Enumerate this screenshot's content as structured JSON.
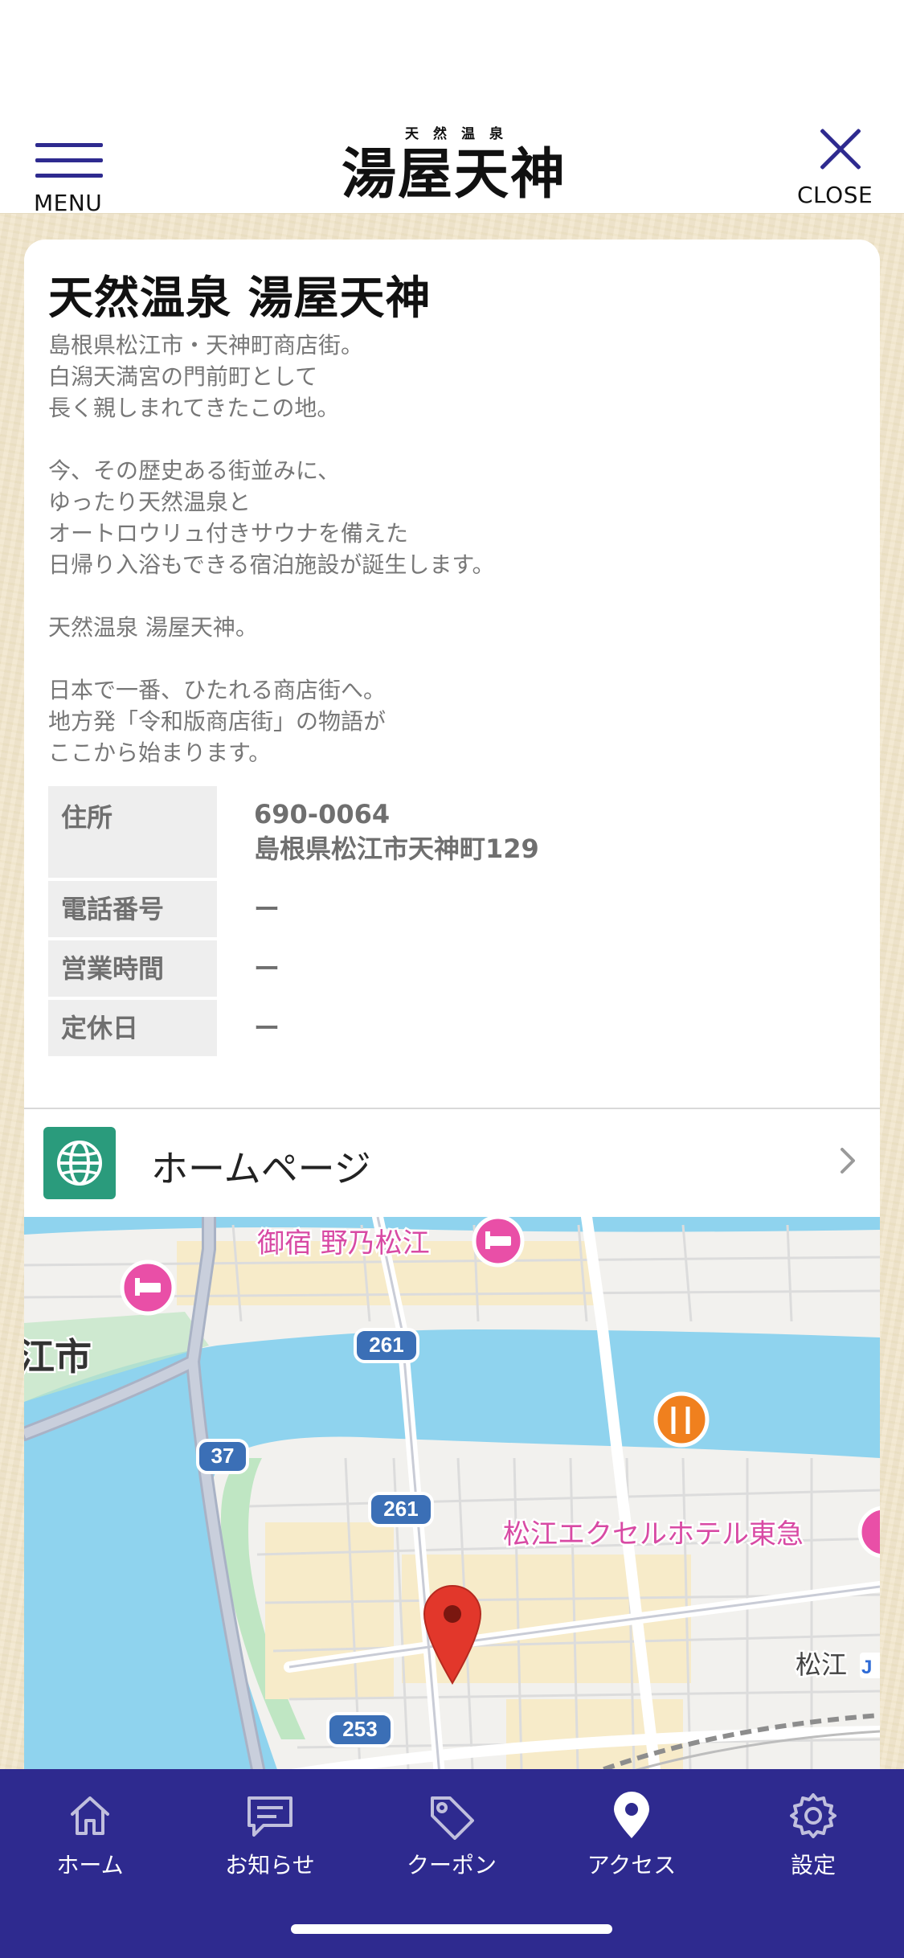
{
  "header": {
    "menu_label": "MENU",
    "logo_sub": "天然温泉",
    "logo_main": "湯屋天神",
    "close_label": "CLOSE"
  },
  "shop": {
    "title": "天然温泉 湯屋天神",
    "description": [
      "島根県松江市・天神町商店街。",
      "白潟天満宮の門前町として",
      "長く親しまれてきたこの地。",
      "",
      "今、その歴史ある街並みに、",
      "ゆったり天然温泉と",
      "オートロウリュ付きサウナを備えた",
      "日帰り入浴もできる宿泊施設が誕生します。",
      "",
      "天然温泉 湯屋天神。",
      "",
      "日本で一番、ひたれる商店街へ。",
      "地方発「令和版商店街」の物語が",
      "ここから始まります。"
    ],
    "info": {
      "address_key": "住所",
      "address_zip": "690-0064",
      "address_line": "島根県松江市天神町129",
      "phone_key": "電話番号",
      "phone_val": "ー",
      "hours_key": "営業時間",
      "hours_val": "ー",
      "holiday_key": "定休日",
      "holiday_val": "ー"
    },
    "homepage_label": "ホームページ"
  },
  "map": {
    "labels": {
      "hotel1": "御宿 野乃松江",
      "hotel2": "松江エクセルホテル東急",
      "city": "江市",
      "station": "松江",
      "route261a": "261",
      "route261b": "261",
      "route37": "37",
      "route253": "253"
    },
    "colors": {
      "water": "#8fd3ee",
      "road": "#ffffff",
      "route_shield": "#3b6fb6",
      "pin": "#e2372b",
      "hotel_poi": "#e94fa7",
      "food_poi": "#f0801e"
    }
  },
  "tabbar": {
    "items": [
      {
        "label": "ホーム",
        "icon": "home-icon"
      },
      {
        "label": "お知らせ",
        "icon": "news-icon"
      },
      {
        "label": "クーポン",
        "icon": "coupon-tag-icon"
      },
      {
        "label": "アクセス",
        "icon": "location-pin-icon"
      },
      {
        "label": "設定",
        "icon": "gear-icon"
      }
    ],
    "active_index": 3,
    "bg_color": "#2e2a8f"
  }
}
